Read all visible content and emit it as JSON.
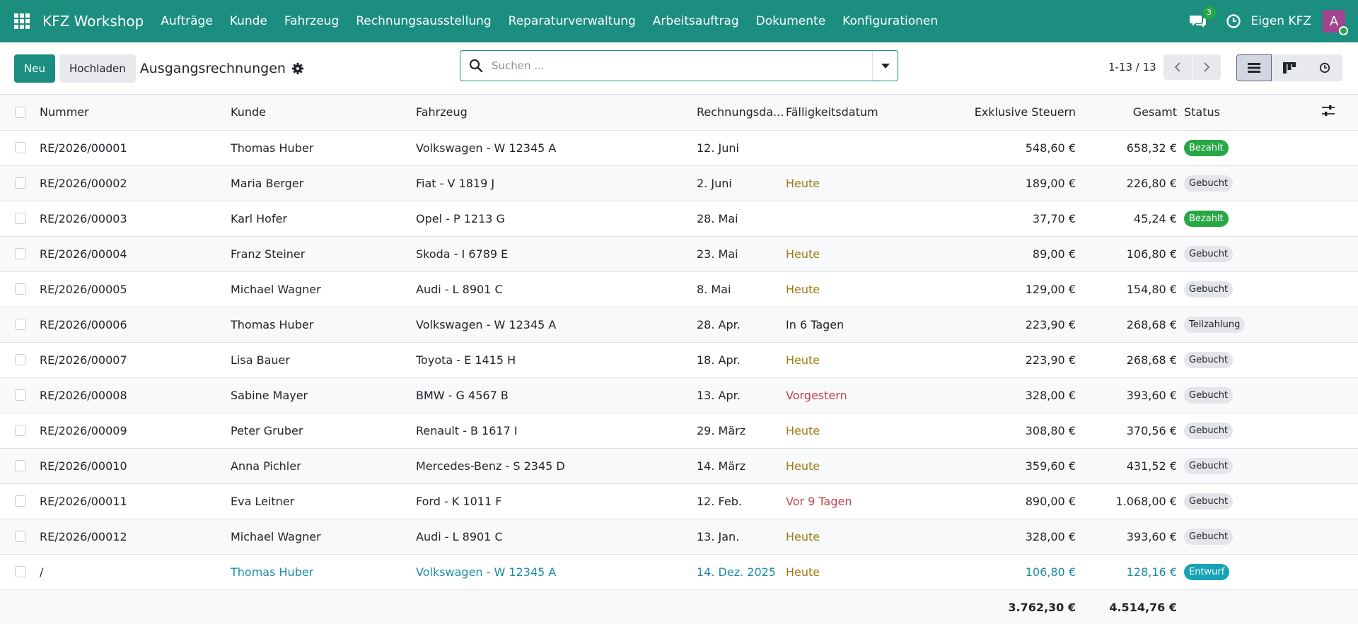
{
  "navbar": {
    "brand": "KFZ Workshop",
    "menu": [
      "Aufträge",
      "Kunde",
      "Fahrzeug",
      "Rechnungsausstellung",
      "Reparaturverwaltung",
      "Arbeitsauftrag",
      "Dokumente",
      "Konfigurationen"
    ],
    "chat_count": "3",
    "company": "Eigen KFZ",
    "avatar_letter": "A",
    "colors": {
      "bar": "#1b8e80",
      "avatar": "#a2458f",
      "online": "#27a844"
    }
  },
  "control": {
    "new_label": "Neu",
    "upload_label": "Hochladen",
    "breadcrumb": "Ausgangsrechnungen",
    "search_placeholder": "Suchen ...",
    "pager": "1-13 / 13"
  },
  "columns": {
    "number": "Nummer",
    "customer": "Kunde",
    "vehicle": "Fahrzeug",
    "invoice_date": "Rechnungsda...",
    "due_date": "Fälligkeitsdatum",
    "excl_tax": "Exklusive Steuern",
    "total": "Gesamt",
    "status": "Status"
  },
  "rows": [
    {
      "number": "RE/2026/00001",
      "customer": "Thomas Huber",
      "vehicle": "Volkswagen - W 12345 A",
      "invoice_date": "12. Juni",
      "due": "",
      "due_style": "",
      "excl": "548,60 €",
      "total": "658,32 €",
      "status": "Bezahlt",
      "status_style": "success",
      "draft": false
    },
    {
      "number": "RE/2026/00002",
      "customer": "Maria Berger",
      "vehicle": "Fiat - V 1819 J",
      "invoice_date": "2. Juni",
      "due": "Heute",
      "due_style": "warn",
      "excl": "189,00 €",
      "total": "226,80 €",
      "status": "Gebucht",
      "status_style": "secondary",
      "draft": false
    },
    {
      "number": "RE/2026/00003",
      "customer": "Karl Hofer",
      "vehicle": "Opel - P 1213 G",
      "invoice_date": "28. Mai",
      "due": "",
      "due_style": "",
      "excl": "37,70 €",
      "total": "45,24 €",
      "status": "Bezahlt",
      "status_style": "success",
      "draft": false
    },
    {
      "number": "RE/2026/00004",
      "customer": "Franz Steiner",
      "vehicle": "Skoda - I 6789 E",
      "invoice_date": "23. Mai",
      "due": "Heute",
      "due_style": "warn",
      "excl": "89,00 €",
      "total": "106,80 €",
      "status": "Gebucht",
      "status_style": "secondary",
      "draft": false
    },
    {
      "number": "RE/2026/00005",
      "customer": "Michael Wagner",
      "vehicle": "Audi - L 8901 C",
      "invoice_date": "8. Mai",
      "due": "Heute",
      "due_style": "warn",
      "excl": "129,00 €",
      "total": "154,80 €",
      "status": "Gebucht",
      "status_style": "secondary",
      "draft": false
    },
    {
      "number": "RE/2026/00006",
      "customer": "Thomas Huber",
      "vehicle": "Volkswagen - W 12345 A",
      "invoice_date": "28. Apr.",
      "due": "In 6 Tagen",
      "due_style": "",
      "excl": "223,90 €",
      "total": "268,68 €",
      "status": "Teilzahlung",
      "status_style": "secondary",
      "draft": false
    },
    {
      "number": "RE/2026/00007",
      "customer": "Lisa Bauer",
      "vehicle": "Toyota - E 1415 H",
      "invoice_date": "18. Apr.",
      "due": "Heute",
      "due_style": "warn",
      "excl": "223,90 €",
      "total": "268,68 €",
      "status": "Gebucht",
      "status_style": "secondary",
      "draft": false
    },
    {
      "number": "RE/2026/00008",
      "customer": "Sabine Mayer",
      "vehicle": "BMW - G 4567 B",
      "invoice_date": "13. Apr.",
      "due": "Vorgestern",
      "due_style": "danger",
      "excl": "328,00 €",
      "total": "393,60 €",
      "status": "Gebucht",
      "status_style": "secondary",
      "draft": false
    },
    {
      "number": "RE/2026/00009",
      "customer": "Peter Gruber",
      "vehicle": "Renault - B 1617 I",
      "invoice_date": "29. März",
      "due": "Heute",
      "due_style": "warn",
      "excl": "308,80 €",
      "total": "370,56 €",
      "status": "Gebucht",
      "status_style": "secondary",
      "draft": false
    },
    {
      "number": "RE/2026/00010",
      "customer": "Anna Pichler",
      "vehicle": "Mercedes-Benz - S 2345 D",
      "invoice_date": "14. März",
      "due": "Heute",
      "due_style": "warn",
      "excl": "359,60 €",
      "total": "431,52 €",
      "status": "Gebucht",
      "status_style": "secondary",
      "draft": false
    },
    {
      "number": "RE/2026/00011",
      "customer": "Eva Leitner",
      "vehicle": "Ford - K 1011 F",
      "invoice_date": "12. Feb.",
      "due": "Vor 9 Tagen",
      "due_style": "danger",
      "excl": "890,00 €",
      "total": "1.068,00 €",
      "status": "Gebucht",
      "status_style": "secondary",
      "draft": false
    },
    {
      "number": "RE/2026/00012",
      "customer": "Michael Wagner",
      "vehicle": "Audi - L 8901 C",
      "invoice_date": "13. Jan.",
      "due": "Heute",
      "due_style": "warn",
      "excl": "328,00 €",
      "total": "393,60 €",
      "status": "Gebucht",
      "status_style": "secondary",
      "draft": false
    },
    {
      "number": "/",
      "customer": "Thomas Huber",
      "vehicle": "Volkswagen - W 12345 A",
      "invoice_date": "14. Dez. 2025",
      "due": "Heute",
      "due_style": "warn",
      "excl": "106,80 €",
      "total": "128,16 €",
      "status": "Entwurf",
      "status_style": "info",
      "draft": true
    }
  ],
  "totals": {
    "excl": "3.762,30 €",
    "total": "4.514,76 €"
  },
  "colors": {
    "success": "#28a745",
    "secondary": "#e3e5e8",
    "info": "#17a2b8",
    "warn": "#9e7b11",
    "danger": "#c0454d",
    "draft_text": "#1b8ba6"
  }
}
